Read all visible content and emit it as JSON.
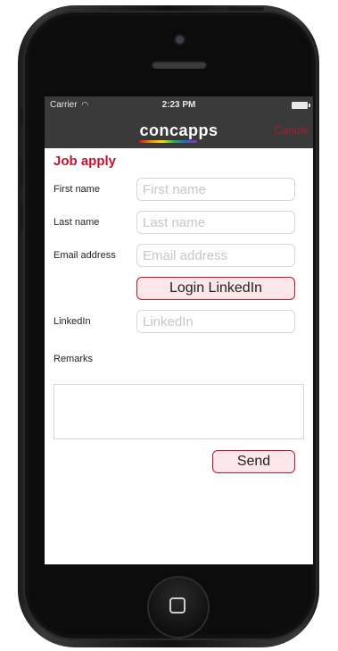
{
  "status_bar": {
    "carrier": "Carrier",
    "time": "2:23 PM"
  },
  "nav": {
    "logo": "concapps",
    "cancel": "Cancel"
  },
  "form": {
    "title": "Job apply",
    "first_name": {
      "label": "First name",
      "placeholder": "First name"
    },
    "last_name": {
      "label": "Last name",
      "placeholder": "Last name"
    },
    "email": {
      "label": "Email address",
      "placeholder": "Email address"
    },
    "login_linkedin_label": "Login LinkedIn",
    "linkedin": {
      "label": "LinkedIn",
      "placeholder": "LinkedIn"
    },
    "remarks": {
      "label": "Remarks"
    },
    "send_label": "Send"
  },
  "colors": {
    "accent": "#c4122f",
    "nav_background": "#3a3a3a",
    "button_fill": "#fbe6ea"
  }
}
